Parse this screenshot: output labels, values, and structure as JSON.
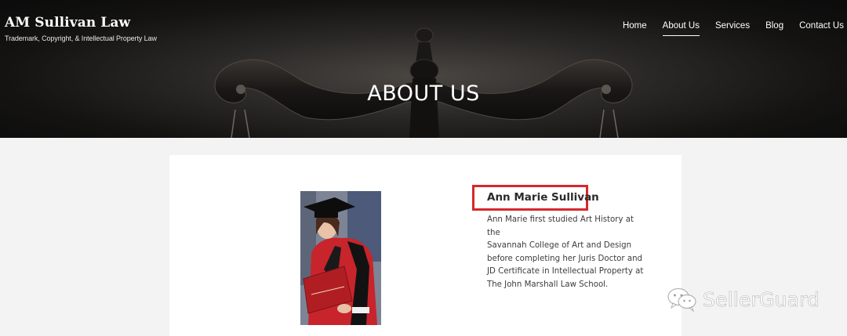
{
  "site": {
    "title": "AM Sullivan Law",
    "tagline": "Trademark, Copyright, & Intellectual Property Law"
  },
  "nav": {
    "items": [
      {
        "label": "Home",
        "active": false
      },
      {
        "label": "About Us",
        "active": true
      },
      {
        "label": "Services",
        "active": false
      },
      {
        "label": "Blog",
        "active": false
      },
      {
        "label": "Contact Us",
        "active": false
      }
    ]
  },
  "hero": {
    "title": "ABOUT US"
  },
  "profile": {
    "name": "Ann Marie Sullivan",
    "bio_lines": [
      "Ann Marie first studied Art History at the",
      "Savannah College of Art and Design",
      "before completing her Juris Doctor and",
      "JD Certificate in Intellectual Property at",
      "The John Marshall Law School."
    ],
    "highlight_color": "#d7272c"
  },
  "watermark": {
    "text": "SellerGuard",
    "icon": "wechat-icon"
  }
}
